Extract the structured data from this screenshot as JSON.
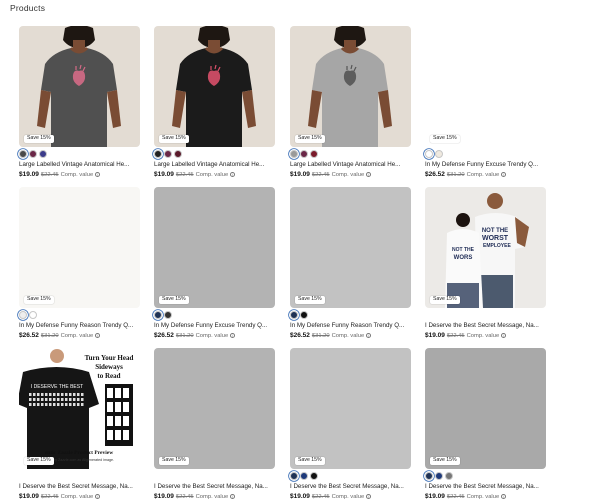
{
  "section_title": "Products",
  "colors": {
    "placeholder_light": "#f8f7f4",
    "placeholder_mid": "#b3b3b3",
    "placeholder_dark": "#a9a9a9",
    "beige_bg": "#e3dcd3"
  },
  "products": [
    {
      "title": "Large Labelled Vintage Anatomical He...",
      "price": "$19.09",
      "old_price": "$22.45",
      "comp": "Comp. value",
      "badge": "Save 15%",
      "image": "woman-charcoal-heart-tee",
      "swatches": [
        "#4a4a4a",
        "#6a2747",
        "#3c3c8a"
      ]
    },
    {
      "title": "Large Labelled Vintage Anatomical He...",
      "price": "$19.09",
      "old_price": "$22.45",
      "comp": "Comp. value",
      "badge": "Save 15%",
      "image": "woman-black-heart-tee",
      "swatches": [
        "#222222",
        "#6a2747",
        "#5a1a2a"
      ]
    },
    {
      "title": "Large Labelled Vintage Anatomical He...",
      "price": "$19.09",
      "old_price": "$22.45",
      "comp": "Comp. value",
      "badge": "Save 15%",
      "image": "woman-grey-heart-tee",
      "swatches": [
        "#9a9a9a",
        "#6a2747",
        "#7a1a2a"
      ]
    },
    {
      "title": "In My Defense Funny Excuse Trendy Q...",
      "price": "$26.52",
      "old_price": "$31.20",
      "comp": "Comp. value",
      "badge": "Save 15%",
      "image": "blank",
      "swatches": [
        "#ffffff",
        "#efe9df"
      ]
    },
    {
      "title": "In My Defense Funny Reason Trendy Q...",
      "price": "$26.52",
      "old_price": "$31.20",
      "comp": "Comp. value",
      "badge": "Save 15%",
      "image": "placeholder-light",
      "swatches": [
        "#eeeeee",
        "#ffffff"
      ]
    },
    {
      "title": "In My Defense Funny Excuse Trendy Q...",
      "price": "$26.52",
      "old_price": "$31.20",
      "comp": "Comp. value",
      "badge": "Save 15%",
      "image": "placeholder-mid",
      "swatches": [
        "#1f3356",
        "#333333"
      ]
    },
    {
      "title": "In My Defense Funny Reason Trendy Q...",
      "price": "$26.52",
      "old_price": "$31.20",
      "comp": "Comp. value",
      "badge": "Save 15%",
      "image": "placeholder-light-grey",
      "swatches": [
        "#1f3356",
        "#111111"
      ]
    },
    {
      "title": "I Deserve the Best Secret Message, Na...",
      "price": "$19.09",
      "old_price": "$22.45",
      "comp": "Comp. value",
      "badge": "Save 15%",
      "image": "couple-white-tees",
      "shirt_text": [
        "NOT THE",
        "WORST",
        "EMPLOYEE"
      ],
      "swatches": []
    },
    {
      "title": "I Deserve the Best Secret Message, Na...",
      "price": "$19.09",
      "old_price": "$22.45",
      "comp": "Comp. value",
      "badge": "Save 15%",
      "image": "man-black-tee-preview",
      "preview_text": [
        "Turn Your Head",
        "Sideways",
        "to Read"
      ],
      "shirt_text": "I DESERVE THE BEST",
      "preview_caption": "entic Zazzle Product Preview",
      "preview_sub": "rated by Zazzle.com as Allgenerated image.",
      "swatches": []
    },
    {
      "title": "I Deserve the Best Secret Message, Na...",
      "price": "$19.09",
      "old_price": "$22.45",
      "comp": "Comp. value",
      "badge": "Save 15%",
      "image": "placeholder-mid",
      "swatches": []
    },
    {
      "title": "I Deserve the Best Secret Message, Na...",
      "price": "$19.09",
      "old_price": "$22.45",
      "comp": "Comp. value",
      "badge": "Save 15%",
      "image": "placeholder-light-grey",
      "swatches": [
        "#1f3356",
        "#1f3a7a",
        "#111111"
      ]
    },
    {
      "title": "I Deserve the Best Secret Message, Na...",
      "price": "$19.09",
      "old_price": "$22.45",
      "comp": "Comp. value",
      "badge": "Save 15%",
      "image": "placeholder-dark",
      "swatches": [
        "#1f3356",
        "#1f3a7a",
        "#777777"
      ]
    }
  ]
}
